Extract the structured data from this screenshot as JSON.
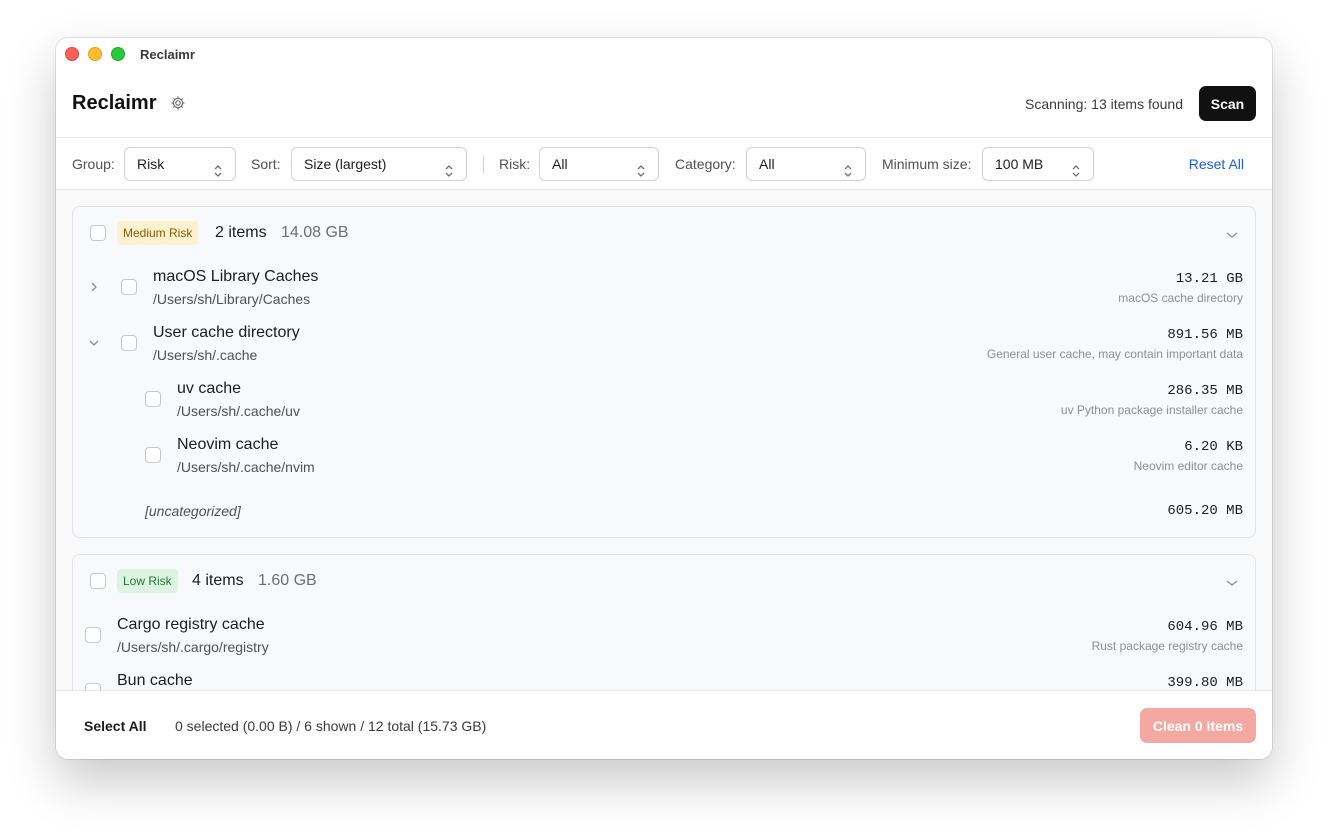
{
  "window": {
    "title": "Reclaimr"
  },
  "header": {
    "title": "Reclaimr",
    "status": "Scanning: 13 items found",
    "scan_label": "Scan"
  },
  "filters": {
    "group_label": "Group:",
    "group_value": "Risk",
    "sort_label": "Sort:",
    "sort_value": "Size (largest)",
    "risk_label": "Risk:",
    "risk_value": "All",
    "category_label": "Category:",
    "category_value": "All",
    "min_size_label": "Minimum size:",
    "min_size_value": "100 MB",
    "reset_label": "Reset All"
  },
  "groups": [
    {
      "badge": "Medium Risk",
      "count": "2 items",
      "size": "14.08 GB",
      "items": [
        {
          "name": "macOS Library Caches",
          "path": "/Users/sh/Library/Caches",
          "size": "13.21 GB",
          "desc": "macOS cache directory"
        },
        {
          "name": "User cache directory",
          "path": "/Users/sh/.cache",
          "size": "891.56 MB",
          "desc": "General user cache, may contain important data"
        },
        {
          "name": "uv cache",
          "path": "/Users/sh/.cache/uv",
          "size": "286.35 MB",
          "desc": "uv Python package installer cache"
        },
        {
          "name": "Neovim cache",
          "path": "/Users/sh/.cache/nvim",
          "size": "6.20 KB",
          "desc": "Neovim editor cache"
        }
      ],
      "uncategorized": {
        "label": "[uncategorized]",
        "size": "605.20 MB"
      }
    },
    {
      "badge": "Low Risk",
      "count": "4 items",
      "size": "1.60 GB",
      "items": [
        {
          "name": "Cargo registry cache",
          "path": "/Users/sh/.cargo/registry",
          "size": "604.96 MB",
          "desc": "Rust package registry cache"
        },
        {
          "name": "Bun cache",
          "path": "",
          "size": "399.80 MB",
          "desc": ""
        }
      ]
    }
  ],
  "footer": {
    "select_all_label": "Select All",
    "summary": "0 selected (0.00 B) / 6 shown / 12 total (15.73 GB)",
    "clean_label": "Clean 0 items"
  },
  "colors": {
    "medium_risk_badge_bg": "#fdf1cf",
    "low_risk_badge_bg": "#dff3e3",
    "scan_button": "#111111",
    "clean_button_disabled": "#f4a8a2",
    "link": "#1a5fd6"
  },
  "icons": {
    "settings": "gear-icon",
    "select_chevrons": "chevron-up-down-icon",
    "collapse": "chevron-down-icon",
    "expand": "chevron-right-icon"
  }
}
